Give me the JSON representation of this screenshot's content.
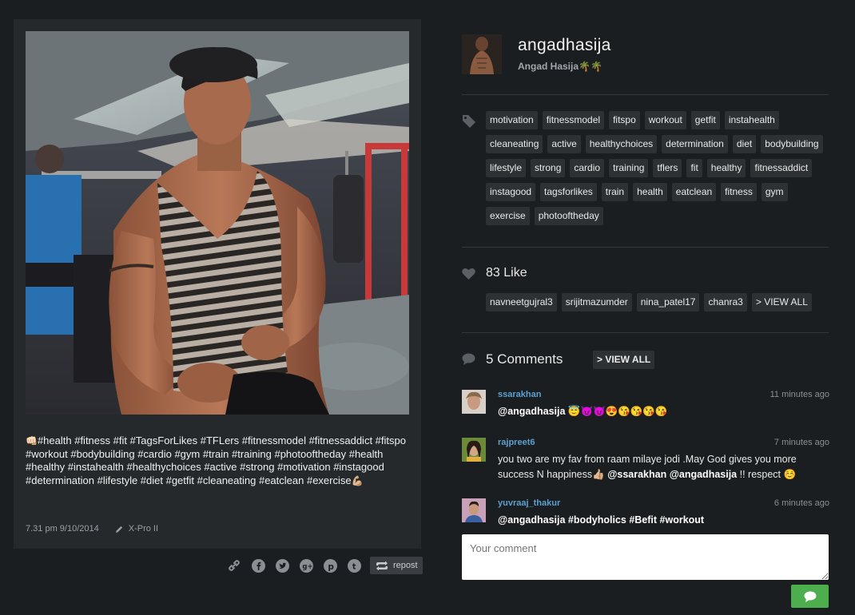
{
  "post": {
    "caption": "#health #fitness #fit #TagsForLikes #TFLers #fitnessmodel #fitnessaddict #fitspo #workout #bodybuilding #cardio #gym #train #training #photooftheday #health #healthy #instahealth #healthychoices #active #strong #motivation #instagood #determination #lifestyle #diet #getfit #cleaneating #eatclean #exercise",
    "caption_prefix_emoji": "👊🏻",
    "caption_suffix_emoji": "💪🏼",
    "timestamp": "7.31 pm 9/10/2014",
    "filter": "X-Pro II"
  },
  "share": {
    "icons": [
      "link-icon",
      "facebook-icon",
      "twitter-icon",
      "google-plus-icon",
      "pinterest-icon",
      "tumblr-icon"
    ],
    "repost_label": "repost"
  },
  "profile": {
    "username": "angadhasija",
    "full_name": "Angad Hasija",
    "full_name_suffix": "🌴🌴"
  },
  "tags": [
    "motivation",
    "fitnessmodel",
    "fitspo",
    "workout",
    "getfit",
    "instahealth",
    "cleaneating",
    "active",
    "healthychoices",
    "determination",
    "diet",
    "bodybuilding",
    "lifestyle",
    "strong",
    "cardio",
    "training",
    "tflers",
    "fit",
    "healthy",
    "fitnessaddict",
    "instagood",
    "tagsforlikes",
    "train",
    "health",
    "eatclean",
    "fitness",
    "gym",
    "exercise",
    "photooftheday"
  ],
  "likes": {
    "count_label": "83 Like",
    "users": [
      "navneetgujral3",
      "srijitmazumder",
      "nina_patel17",
      "chanra3"
    ],
    "view_all_label": "> VIEW ALL"
  },
  "comments": {
    "title": "5 Comments",
    "view_all_label": "> VIEW ALL",
    "items": [
      {
        "user": "ssarakhan",
        "time": "11 minutes ago",
        "mention": "@angadhasija",
        "text": "",
        "emoji": "😇😈😈😍😘😘😘😘"
      },
      {
        "user": "rajpreet6",
        "time": "7 minutes ago",
        "text": "you two are my fav from raam milaye jodi .May God gives you more success N happiness",
        "emoji": "👍🏼",
        "mention": "@ssarakhan @angadhasija",
        "tail": " !! respect",
        "tail_emoji": "☺️"
      },
      {
        "user": "yuvraaj_thakur",
        "time": "6 minutes ago",
        "text": "@angadhasija #bodyholics #Befit #workout"
      }
    ]
  },
  "comment_input": {
    "placeholder": "Your comment"
  },
  "colors": {
    "background": "#1b1e20",
    "card": "#25292c",
    "tag_bg": "#2d3134",
    "link_blue": "#5ba0d0",
    "send_green": "#4cae4c"
  }
}
